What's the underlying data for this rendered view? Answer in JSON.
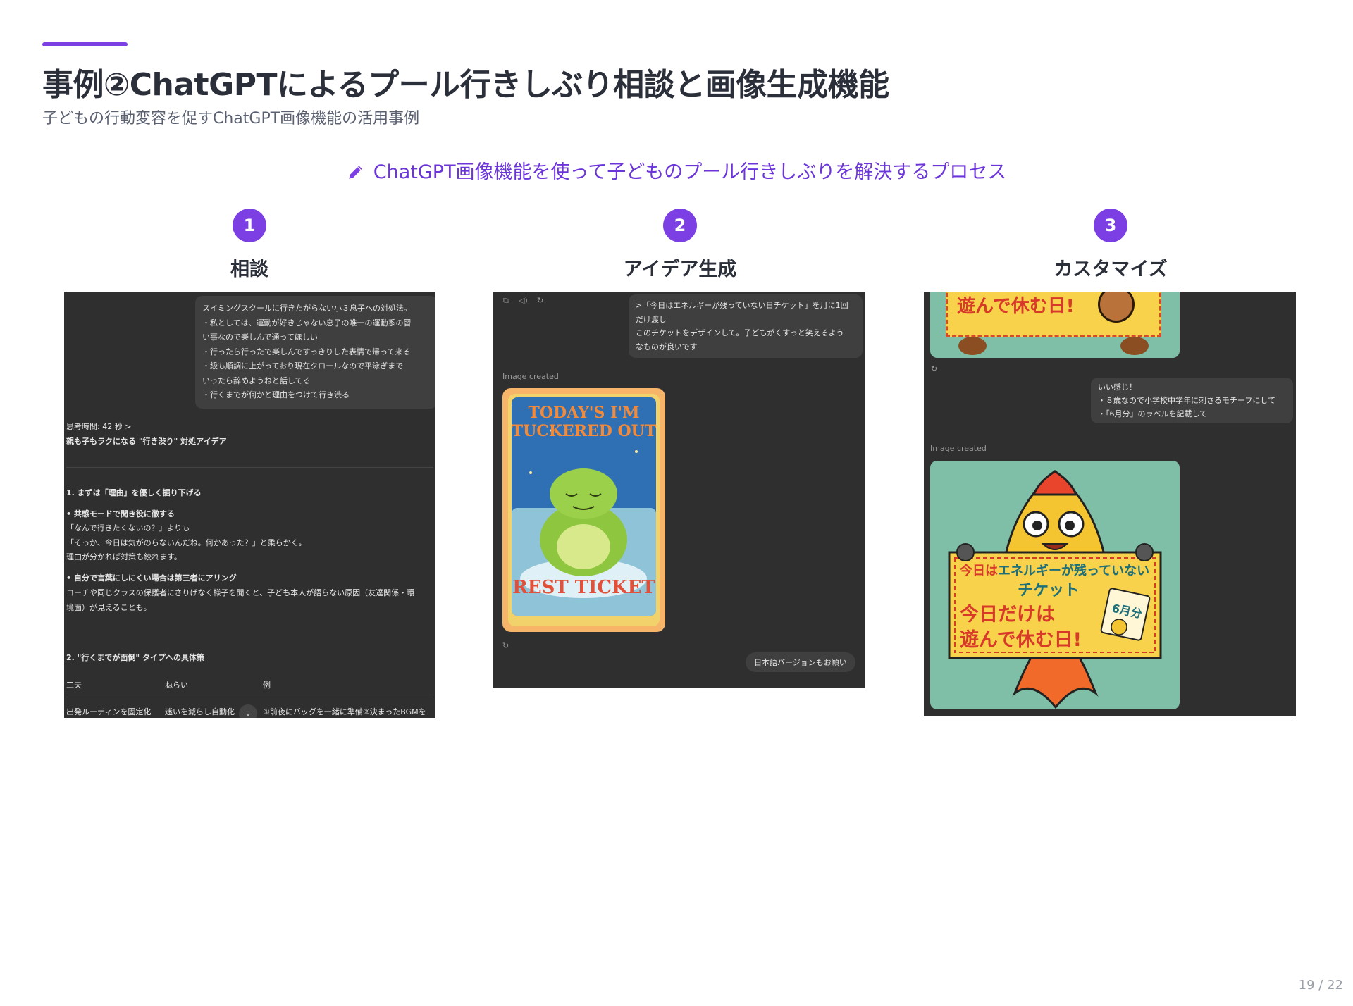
{
  "header": {
    "title": "事例②ChatGPTによるプール行きしぶり相談と画像生成機能",
    "subtitle": "子どもの行動変容を促すChatGPT画像機能の活用事例"
  },
  "process": {
    "icon": "pencil-icon",
    "text": "ChatGPT画像機能を使って子どものプール行きしぶりを解決するプロセス"
  },
  "steps": [
    {
      "num": "1",
      "label": "相談"
    },
    {
      "num": "2",
      "label": "アイデア生成"
    },
    {
      "num": "3",
      "label": "カスタマイズ"
    }
  ],
  "panel1": {
    "bubble": [
      "スイミングスクールに行きたがらない小３息子への対処法。",
      "・私としては、運動が好きじゃない息子の唯一の運動系の習",
      "い事なので楽しんで通ってほしい",
      "・行ったら行ったで楽しんですっきりした表情で帰って来る",
      "・級も順調に上がっており現在クロールなので平泳ぎまで",
      "いったら辞めようねと話してる",
      "・行くまでが何かと理由をつけて行き渋る"
    ],
    "thinking": "思考時間: 42 秒 >",
    "heading": "親も子もラクになる \"行き渋り\" 対処アイデア",
    "s1_title": "1. まずは「理由」を優しく掘り下げる",
    "s1_b1": "• 共感モードで聞き役に徹する",
    "s1_l1": "「なんで行きたくないの？」よりも",
    "s1_l2": "「そっか、今日は気がのらないんだね。何かあった？」と柔らかく。",
    "s1_l3": "理由が分かれば対策も絞れます。",
    "s1_b2": "• 自分で言葉にしにくい場合は第三者にアリング",
    "s1_l4": "コーチや同じクラスの保護者にさりげなく様子を聞くと、子ども本人が語らない原因（友達関係・環",
    "s1_l5": "境面）が見えることも。",
    "s2_title": "2. \"行くまでが面倒\" タイプへの具体策",
    "table_headers": [
      "工夫",
      "ねらい",
      "例"
    ],
    "table_row": [
      "出発ルーティンを固定化",
      "迷いを減らし自動化",
      "①前夜にバッグを一緒に準備②決まったBGMを"
    ]
  },
  "panel2": {
    "bubble": [
      ">「今日はエネルギーが残っていない日チケット」を月に1回",
      "だけ渡し",
      "このチケットをデザインして。子どもがくすっと笑えるよう",
      "なものが良いです"
    ],
    "image_label": "Image created",
    "ticket_top1": "TODAY'S I'M",
    "ticket_top2": "TUCKERED OUT",
    "ticket_bottom": "REST TICKET",
    "followup": "日本語バージョンもお願い"
  },
  "panel3": {
    "top_text": "遊んで休む日!",
    "bubble": [
      "いい感じ！",
      "・８歳なので小学校中学年に刺さるモチーフにして",
      "・「6月分」のラベルを記載して"
    ],
    "image_label": "Image created",
    "sign_line1a": "今日は",
    "sign_line1b": "エネルギーが残っていない",
    "sign_line2": "チケット",
    "sign_line3": "今日だけは",
    "sign_line4": "遊んで休む日!",
    "calendar": "6月分"
  },
  "footer": {
    "page": "19 / 22"
  },
  "colors": {
    "accent": "#7b3fe4",
    "panel_bg": "#2f2f2f"
  }
}
